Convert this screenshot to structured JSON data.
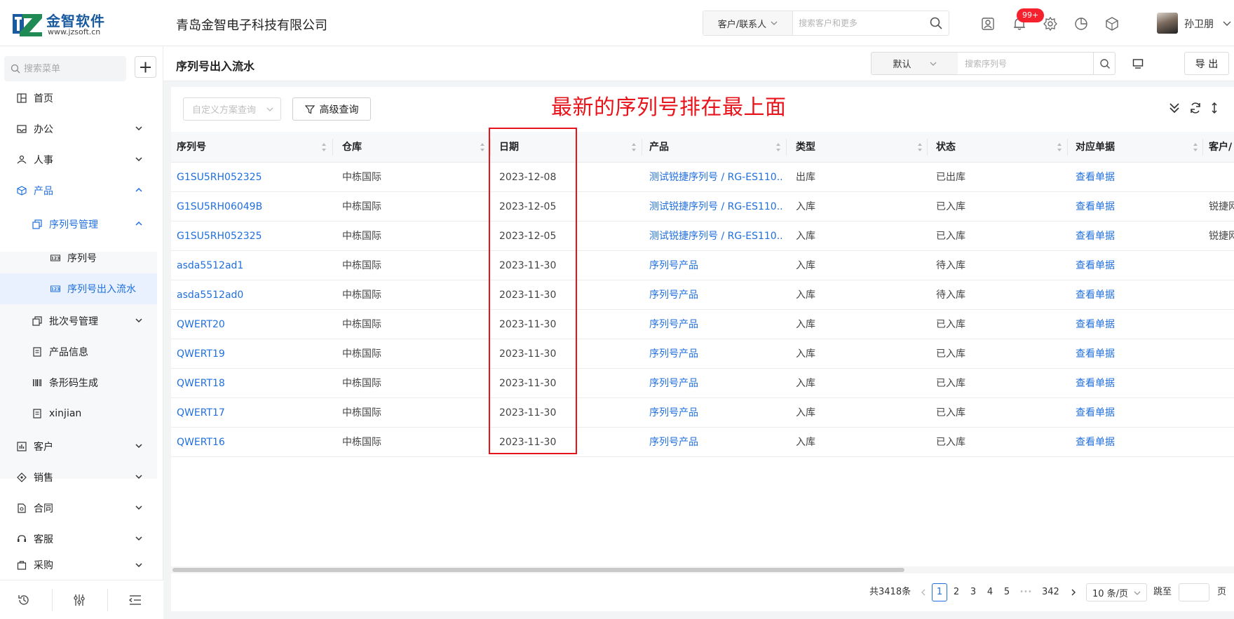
{
  "brand": {
    "name_cn": "金智软件",
    "domain": "www.jzsoft.cn",
    "accent": "#1f6fde",
    "logo_color": "#1a5ba0"
  },
  "header": {
    "company": "青岛金智电子科技有限公司",
    "search_scope": "客户/联系人",
    "search_placeholder": "搜索客户和更多",
    "notification_badge": "99+",
    "user_name": "孙卫朋",
    "icons": [
      "contact-card-icon",
      "bell-icon",
      "gear-icon",
      "pie-chart-icon",
      "cube-icon"
    ]
  },
  "sidebar": {
    "search_placeholder": "搜索菜单",
    "items": [
      {
        "label": "首页",
        "icon": "grid-icon"
      },
      {
        "label": "办公",
        "icon": "inbox-icon"
      },
      {
        "label": "人事",
        "icon": "people-icon"
      },
      {
        "label": "产品",
        "icon": "cube-icon"
      },
      {
        "label": "序列号管理",
        "icon": "copy-icon"
      },
      {
        "label": "序列号",
        "icon": "numbers-icon"
      },
      {
        "label": "序列号出入流水",
        "icon": "numbers-icon"
      },
      {
        "label": "批次号管理",
        "icon": "copy-icon"
      },
      {
        "label": "产品信息",
        "icon": "doc-icon"
      },
      {
        "label": "条形码生成",
        "icon": "barcode-icon"
      },
      {
        "label": "xinjian",
        "icon": "doc-icon"
      },
      {
        "label": "客户",
        "icon": "chart-icon"
      },
      {
        "label": "销售",
        "icon": "tag-icon"
      },
      {
        "label": "合同",
        "icon": "contract-icon"
      },
      {
        "label": "客服",
        "icon": "headset-icon"
      },
      {
        "label": "采购",
        "icon": "bag-icon"
      }
    ],
    "bottom_icons": [
      "history-icon",
      "sliders-icon",
      "collapse-menu-icon"
    ]
  },
  "page": {
    "title": "序列号出入流水",
    "view_select": "默认",
    "search_placeholder": "搜索序列号",
    "export_label": "导 出"
  },
  "toolbar": {
    "scheme_placeholder": "自定义方案查询",
    "advanced_label": "高级查询",
    "annotation": "最新的序列号排在最上面",
    "annotation_color": "#e8141b"
  },
  "table": {
    "columns": [
      "序列号",
      "仓库",
      "日期",
      "产品",
      "类型",
      "状态",
      "对应单据",
      "客户/"
    ],
    "rows": [
      [
        "G1SU5RH052325",
        "中栋国际",
        "2023-12-08",
        "测试锐捷序列号 / RG-ES110...",
        "出库",
        "已出库",
        "查看单据",
        ""
      ],
      [
        "G1SU5RH06049B",
        "中栋国际",
        "2023-12-05",
        "测试锐捷序列号 / RG-ES110...",
        "入库",
        "已入库",
        "查看单据",
        "锐捷网"
      ],
      [
        "G1SU5RH052325",
        "中栋国际",
        "2023-12-05",
        "测试锐捷序列号 / RG-ES110...",
        "入库",
        "已入库",
        "查看单据",
        "锐捷网"
      ],
      [
        "asda5512ad1",
        "中栋国际",
        "2023-11-30",
        "序列号产品",
        "入库",
        "待入库",
        "查看单据",
        ""
      ],
      [
        "asda5512ad0",
        "中栋国际",
        "2023-11-30",
        "序列号产品",
        "入库",
        "待入库",
        "查看单据",
        ""
      ],
      [
        "QWERT20",
        "中栋国际",
        "2023-11-30",
        "序列号产品",
        "入库",
        "已入库",
        "查看单据",
        ""
      ],
      [
        "QWERT19",
        "中栋国际",
        "2023-11-30",
        "序列号产品",
        "入库",
        "已入库",
        "查看单据",
        ""
      ],
      [
        "QWERT18",
        "中栋国际",
        "2023-11-30",
        "序列号产品",
        "入库",
        "已入库",
        "查看单据",
        ""
      ],
      [
        "QWERT17",
        "中栋国际",
        "2023-11-30",
        "序列号产品",
        "入库",
        "已入库",
        "查看单据",
        ""
      ],
      [
        "QWERT16",
        "中栋国际",
        "2023-11-30",
        "序列号产品",
        "入库",
        "已入库",
        "查看单据",
        ""
      ]
    ]
  },
  "pagination": {
    "total": "共3418条",
    "pages": [
      "1",
      "2",
      "3",
      "4",
      "5"
    ],
    "ellipsis": "•••",
    "last_page": "342",
    "current": "1",
    "page_size": "10 条/页",
    "jump_label": "跳至",
    "page_suffix": "页"
  }
}
